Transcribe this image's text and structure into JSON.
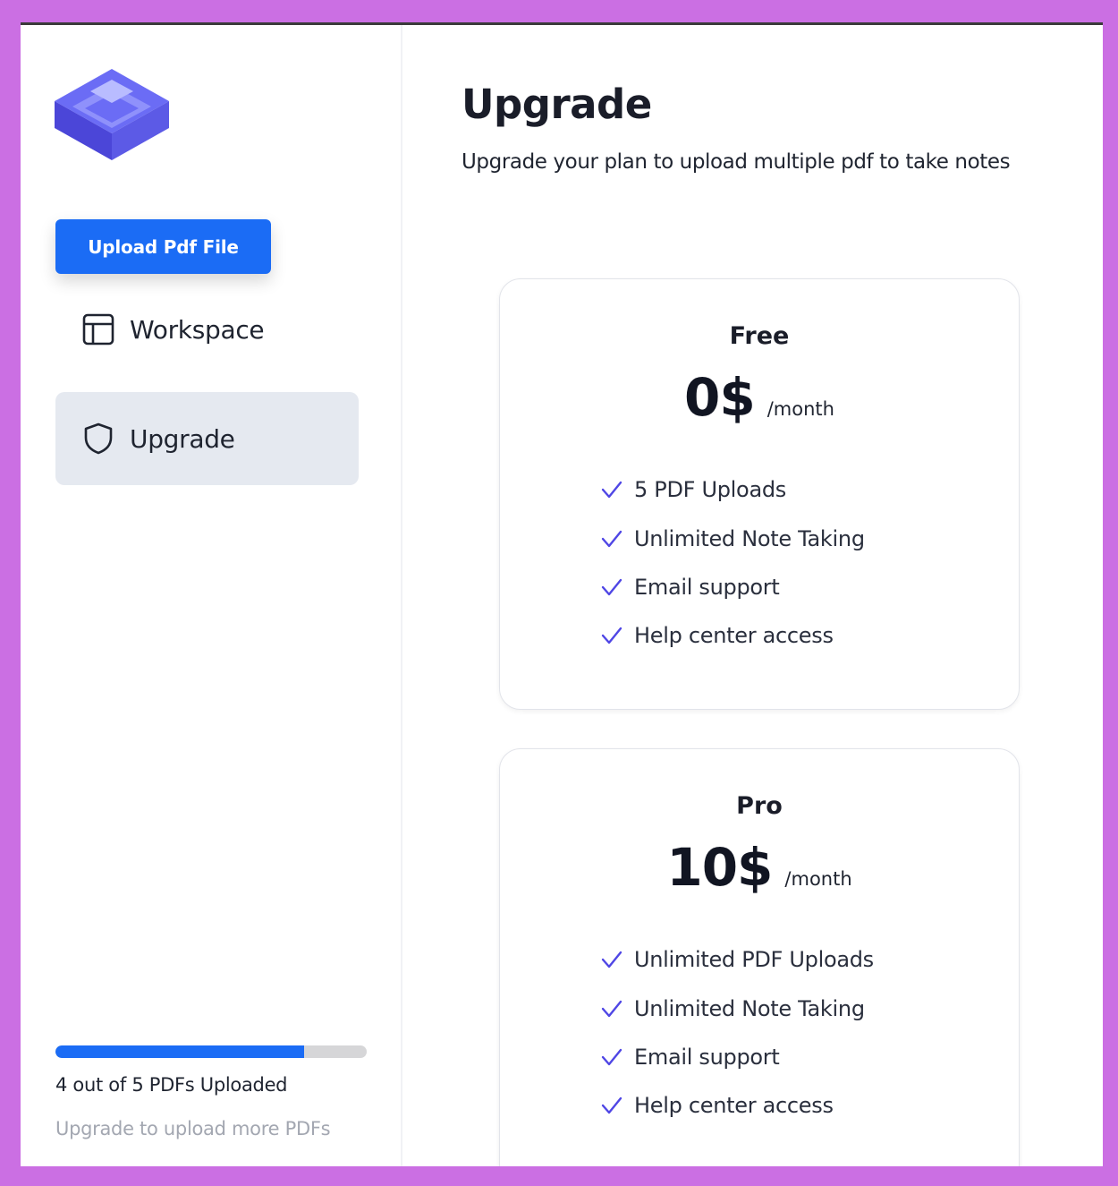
{
  "sidebar": {
    "upload_button": "Upload Pdf File",
    "nav": [
      {
        "label": "Workspace",
        "icon": "layout-icon",
        "active": false
      },
      {
        "label": "Upgrade",
        "icon": "shield-icon",
        "active": true
      }
    ],
    "usage": {
      "uploaded": 4,
      "limit": 5,
      "progress_fraction": 0.8,
      "text": "4 out of 5 PDFs Uploaded",
      "hint": "Upgrade to upload more PDFs"
    }
  },
  "main": {
    "title": "Upgrade",
    "subtitle": "Upgrade your plan to upload multiple pdf to take notes",
    "plans": [
      {
        "name": "Free",
        "price": "0$",
        "period": "/month",
        "features": [
          "5 PDF Uploads",
          "Unlimited Note Taking",
          "Email support",
          "Help center access"
        ]
      },
      {
        "name": "Pro",
        "price": "10$",
        "period": "/month",
        "features": [
          "Unlimited PDF Uploads",
          "Unlimited Note Taking",
          "Email support",
          "Help center access"
        ]
      }
    ]
  },
  "colors": {
    "accent": "#1b6cf5",
    "check": "#4f46e5",
    "active_nav_bg": "#e5e9f0",
    "frame_bg": "#cb6fe3",
    "logo": "#5b5bf0"
  }
}
